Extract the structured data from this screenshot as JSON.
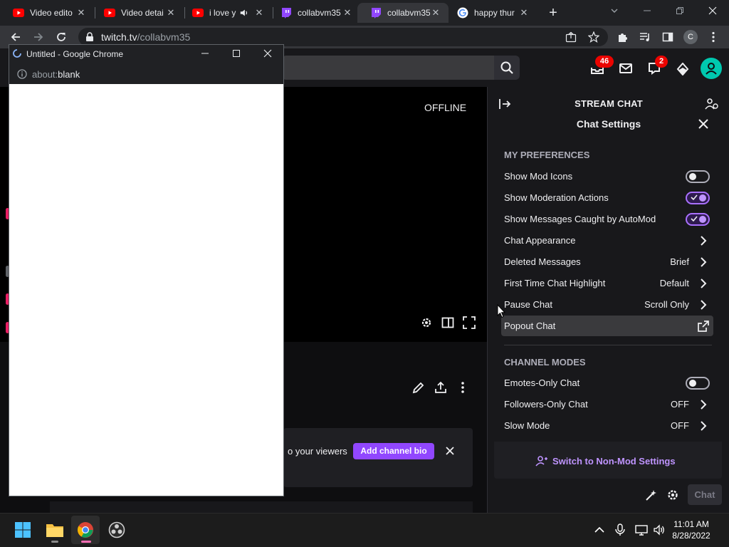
{
  "browser": {
    "tabs": [
      {
        "title": "Video edito",
        "favicon": "youtube-icon"
      },
      {
        "title": "Video detai",
        "favicon": "youtube-icon"
      },
      {
        "title": "i love y",
        "favicon": "youtube-icon"
      },
      {
        "title": "collabvm35",
        "favicon": "twitch-icon"
      },
      {
        "title": "collabvm35",
        "favicon": "twitch-icon"
      },
      {
        "title": "happy thur",
        "favicon": "google-icon"
      }
    ],
    "url_host": "twitch.tv",
    "url_path": "/collabvm35",
    "profile_initial": "C"
  },
  "twitch": {
    "notifications_count": "46",
    "whispers_count": "2",
    "offline_label": "OFFLINE",
    "bio_prompt": "o your viewers",
    "add_bio_label": "Add channel bio"
  },
  "chat": {
    "header": "STREAM CHAT",
    "settings_title": "Chat Settings",
    "my_preferences_header": "MY PREFERENCES",
    "preferences": [
      {
        "label": "Show Mod Icons",
        "type": "toggle",
        "on": false
      },
      {
        "label": "Show Moderation Actions",
        "type": "toggle",
        "on": true
      },
      {
        "label": "Show Messages Caught by AutoMod",
        "type": "toggle",
        "on": true
      },
      {
        "label": "Chat Appearance",
        "type": "link",
        "value": ""
      },
      {
        "label": "Deleted Messages",
        "type": "link",
        "value": "Brief"
      },
      {
        "label": "First Time Chat Highlight",
        "type": "link",
        "value": "Default"
      },
      {
        "label": "Pause Chat",
        "type": "link",
        "value": "Scroll Only"
      }
    ],
    "popout_label": "Popout Chat",
    "channel_modes_header": "CHANNEL MODES",
    "channel_modes": [
      {
        "label": "Emotes-Only Chat",
        "type": "toggle",
        "on": false
      },
      {
        "label": "Followers-Only Chat",
        "type": "link",
        "value": "OFF"
      },
      {
        "label": "Slow Mode",
        "type": "link",
        "value": "OFF"
      }
    ],
    "switch_label": "Switch to Non-Mod Settings",
    "send_label": "Chat"
  },
  "popup": {
    "title": "Untitled - Google Chrome",
    "url_scheme": "about:",
    "url_host": "blank"
  },
  "taskbar": {
    "time": "11:01 AM",
    "date": "8/28/2022"
  },
  "colors": {
    "accent": "#9147ff",
    "accent_light": "#bf94ff",
    "badge": "#eb0400"
  }
}
